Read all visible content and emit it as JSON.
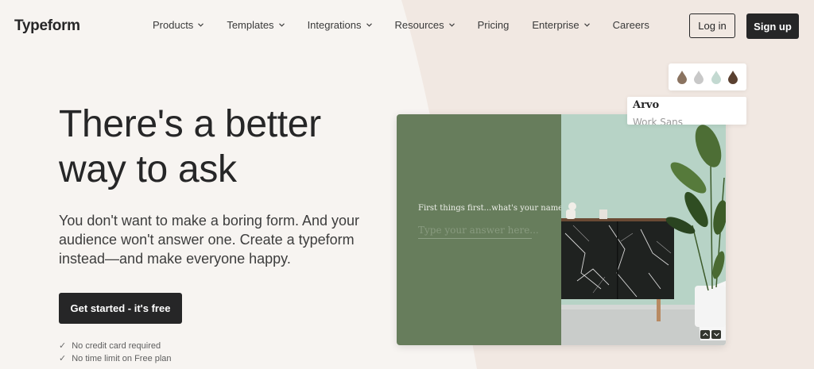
{
  "brand": {
    "logo": "Typeform"
  },
  "nav": {
    "items": [
      {
        "label": "Products",
        "dropdown": true
      },
      {
        "label": "Templates",
        "dropdown": true
      },
      {
        "label": "Integrations",
        "dropdown": true
      },
      {
        "label": "Resources",
        "dropdown": true
      },
      {
        "label": "Pricing",
        "dropdown": false
      },
      {
        "label": "Enterprise",
        "dropdown": true
      },
      {
        "label": "Careers",
        "dropdown": false
      }
    ],
    "login_label": "Log in",
    "signup_label": "Sign up"
  },
  "hero": {
    "headline_line1": "There's a better",
    "headline_line2": "way to ask",
    "subtitle": "You don't want to make a boring form. And your audience won't answer one. Create a typeform instead—and make everyone happy.",
    "cta_label": "Get started - it's free",
    "checks": [
      "No credit card required",
      "No time limit on Free plan"
    ]
  },
  "preview": {
    "question": "First things first...what's your name?",
    "answer_placeholder": "Type your answer here...",
    "palette_colors": [
      "#8a7360",
      "#c8c8c8",
      "#c3d9d1",
      "#5a4030"
    ],
    "fonts": [
      "Arvo",
      "Work Sans"
    ]
  },
  "colors": {
    "accent": "#262627",
    "panel_green": "#677d5c",
    "wall_mint": "#b7d3c6",
    "page_bg": "#f7f4f1"
  }
}
